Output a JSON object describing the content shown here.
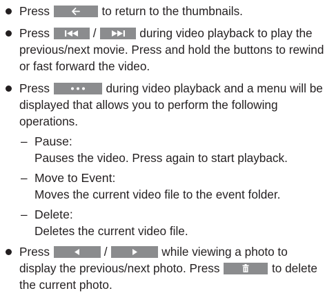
{
  "bullets": {
    "back": {
      "pre": "Press",
      "post": " to return to the thumbnails."
    },
    "skip": {
      "pre": "Press",
      "slash": "/",
      "post": " during video playback to play the previous/next movie. Press and hold the buttons to rewind or fast forward the video."
    },
    "menu": {
      "pre": "Press",
      "post": " during video playback and a menu will be displayed that allows you to perform the following operations."
    },
    "photo": {
      "pre": "Press",
      "slash": "/",
      "mid": " while viewing a photo to display the previous/next photo. Press",
      "post": " to delete the current photo."
    }
  },
  "menu_items": [
    {
      "dash": "–",
      "title": "Pause:",
      "desc": "Pauses the video. Press again to start playback."
    },
    {
      "dash": "–",
      "title": "Move to Event:",
      "desc": "Moves the current video file to the event folder."
    },
    {
      "dash": "–",
      "title": "Delete:",
      "desc": "Deletes the current video file."
    }
  ],
  "icons": {
    "back": "back-arrow-icon",
    "prev": "skip-previous-icon",
    "next": "skip-next-icon",
    "menu": "more-dots-icon",
    "left": "triangle-left-icon",
    "right": "triangle-right-icon",
    "trash": "trash-icon"
  },
  "colors": {
    "text": "#231f20",
    "button_bg": "#8b8c8e",
    "button_fg": "#ffffff"
  }
}
